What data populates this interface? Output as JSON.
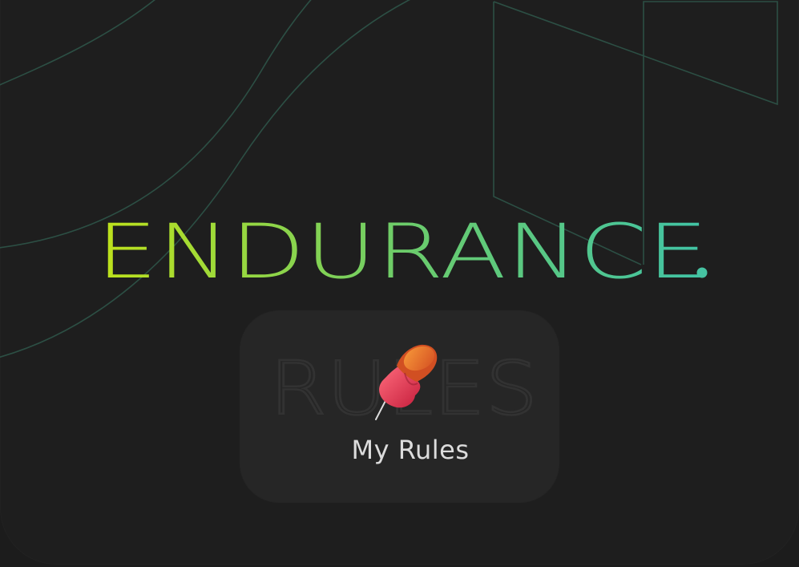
{
  "hero": {
    "title": "ENDURANCE",
    "gradient_start": "#b4dc1f",
    "gradient_end": "#47c6a2"
  },
  "card": {
    "watermark": "RULES",
    "label": "My Rules",
    "icon": "pushpin-icon",
    "background": "#262626"
  },
  "theme": {
    "background": "#1e1e1e",
    "line_color": "#2e5c50"
  }
}
